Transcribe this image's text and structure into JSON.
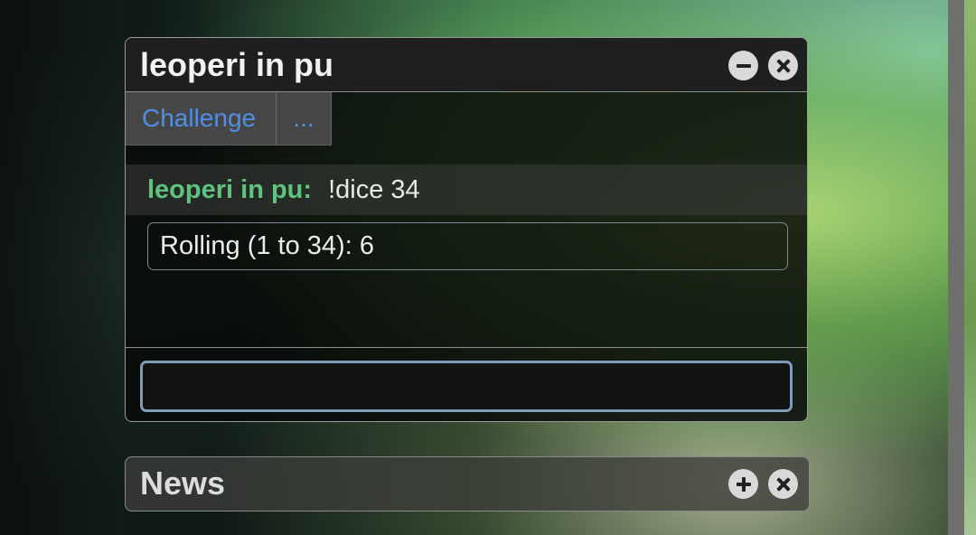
{
  "chat_window": {
    "title": "leoperi in pu",
    "tabs": [
      {
        "label": "Challenge"
      },
      {
        "label": "..."
      }
    ],
    "messages": [
      {
        "user": "leoperi in pu:",
        "text": "!dice 34"
      }
    ],
    "result": "Rolling (1 to 34): 6",
    "input": {
      "value": "",
      "placeholder": ""
    }
  },
  "news_window": {
    "title": "News"
  },
  "icons": {
    "minimize": "minus-circle-icon",
    "close": "close-circle-icon",
    "expand": "plus-circle-icon"
  },
  "colors": {
    "username": "#5ec47d",
    "tab_link": "#4f8fe6",
    "input_border": "#7e9bb8"
  }
}
